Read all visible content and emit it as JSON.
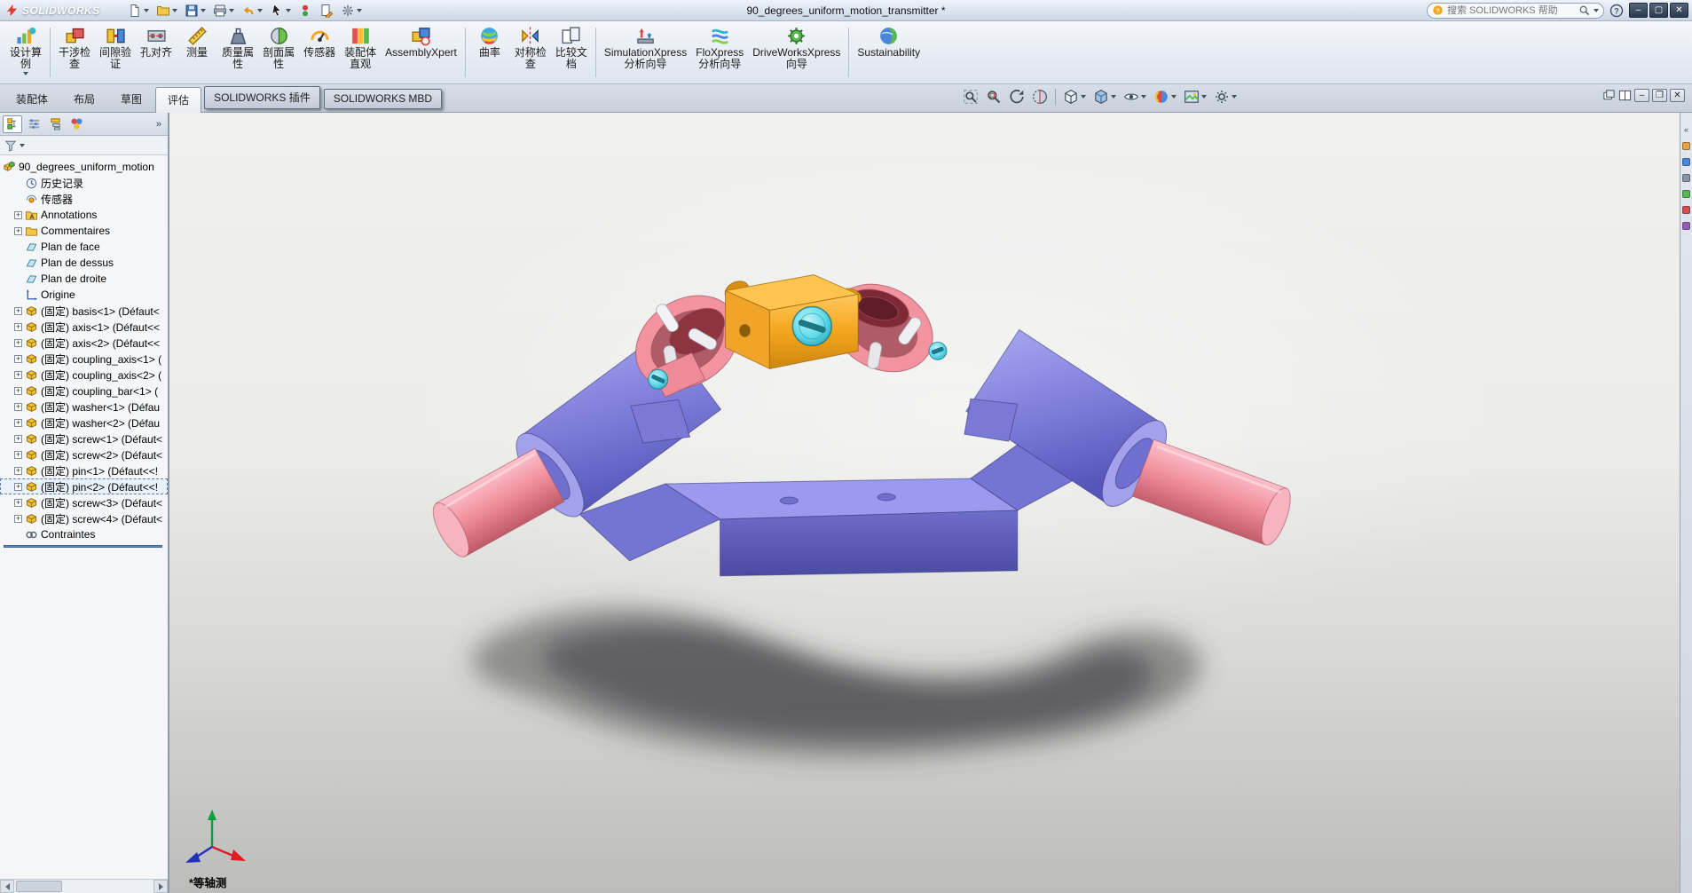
{
  "window": {
    "brand": "SOLIDWORKS",
    "title": "90_degrees_uniform_motion_transmitter *",
    "search_placeholder": "搜索 SOLIDWORKS 帮助"
  },
  "quick_access": [
    {
      "name": "new",
      "caret": true
    },
    {
      "name": "open",
      "caret": true
    },
    {
      "name": "save",
      "caret": true
    },
    {
      "name": "print",
      "caret": true
    },
    {
      "name": "undo",
      "caret": true
    },
    {
      "name": "select",
      "caret": true
    },
    {
      "name": "rebuild",
      "caret": false
    },
    {
      "name": "file-properties",
      "caret": false
    },
    {
      "name": "options",
      "caret": true
    }
  ],
  "command_manager": {
    "items": [
      {
        "label": "设计算\n例",
        "icon": "design-study",
        "caret": true
      },
      {
        "sep": true
      },
      {
        "label": "干涉检\n查",
        "icon": "interference"
      },
      {
        "label": "间隙验\n证",
        "icon": "clearance"
      },
      {
        "label": "孔对齐",
        "icon": "hole-align"
      },
      {
        "label": "测量",
        "icon": "measure"
      },
      {
        "label": "质量属\n性",
        "icon": "mass-props"
      },
      {
        "label": "剖面属\n性",
        "icon": "section-props"
      },
      {
        "label": "传感器",
        "icon": "sensor"
      },
      {
        "label": "装配体\n直观",
        "icon": "assembly-vis"
      },
      {
        "label": "AssemblyXpert",
        "icon": "assemblyxpert"
      },
      {
        "sep": true
      },
      {
        "label": "曲率",
        "icon": "curvature"
      },
      {
        "label": "对称检\n查",
        "icon": "symmetry"
      },
      {
        "label": "比较文\n档",
        "icon": "compare"
      },
      {
        "sep": true
      },
      {
        "label": "SimulationXpress\n分析向导",
        "icon": "simulationxpress"
      },
      {
        "label": "FloXpress\n分析向导",
        "icon": "floxpress"
      },
      {
        "label": "DriveWorksXpress\n向导",
        "icon": "driveworksxpress"
      },
      {
        "sep": true
      },
      {
        "label": "Sustainability",
        "icon": "sustainability"
      }
    ]
  },
  "tabs": {
    "active": 3,
    "items": [
      {
        "name": "assembly",
        "label": "装配体"
      },
      {
        "name": "layout",
        "label": "布局"
      },
      {
        "name": "sketch",
        "label": "草图"
      },
      {
        "name": "evaluate",
        "label": "评估"
      },
      {
        "name": "solidworks-addins",
        "label": "SOLIDWORKS 插件",
        "raised": true
      },
      {
        "name": "solidworks-mbd",
        "label": "SOLIDWORKS MBD",
        "raised": true
      }
    ]
  },
  "headsup": {
    "items": [
      {
        "icon": "zoom-fit"
      },
      {
        "icon": "zoom-area"
      },
      {
        "icon": "previous-view"
      },
      {
        "icon": "section-view"
      },
      {
        "sep": true
      },
      {
        "icon": "view-orientation",
        "caret": true
      },
      {
        "icon": "display-style",
        "caret": true
      },
      {
        "icon": "hide-show",
        "caret": true
      },
      {
        "icon": "edit-appearance",
        "caret": true
      },
      {
        "icon": "apply-scene",
        "caret": true
      },
      {
        "icon": "view-settings",
        "caret": true
      }
    ]
  },
  "doc_controls": [
    {
      "icon": "cascade"
    },
    {
      "icon": "pane"
    },
    {
      "glyph": "doc-minimize"
    },
    {
      "glyph": "doc-restore"
    },
    {
      "glyph": "doc-close"
    }
  ],
  "feature_panel": {
    "tabs": [
      "feature-manager",
      "property-manager",
      "configuration-manager",
      "display-manager"
    ],
    "more_glyph": "»",
    "tree": {
      "items": [
        {
          "name": "root",
          "icon": "assembly",
          "label": "90_degrees_uniform_motion",
          "root": true
        },
        {
          "name": "history",
          "icon": "history",
          "label": "历史记录"
        },
        {
          "name": "sensors",
          "icon": "sensors",
          "label": "传感器"
        },
        {
          "name": "annotations",
          "icon": "annotations",
          "label": "Annotations",
          "expand": true
        },
        {
          "name": "commentaires",
          "icon": "folder",
          "label": "Commentaires",
          "expand": true
        },
        {
          "name": "plan-de-face",
          "icon": "plane",
          "label": "Plan de face"
        },
        {
          "name": "plan-de-dessus",
          "icon": "plane",
          "label": "Plan de dessus"
        },
        {
          "name": "plan-de-droite",
          "icon": "plane",
          "label": "Plan de droite"
        },
        {
          "name": "origine",
          "icon": "origin",
          "label": "Origine"
        },
        {
          "name": "basis-1",
          "icon": "part",
          "label": "(固定) basis<1> (Défaut<",
          "expand": true
        },
        {
          "name": "axis-1",
          "icon": "part",
          "label": "(固定) axis<1> (Défaut<<",
          "expand": true
        },
        {
          "name": "axis-2",
          "icon": "part",
          "label": "(固定) axis<2> (Défaut<<",
          "expand": true
        },
        {
          "name": "coupling-axis-1",
          "icon": "part",
          "label": "(固定) coupling_axis<1> (",
          "expand": true
        },
        {
          "name": "coupling-axis-2",
          "icon": "part",
          "label": "(固定) coupling_axis<2> (",
          "expand": true
        },
        {
          "name": "coupling-bar-1",
          "icon": "part",
          "label": "(固定) coupling_bar<1> (",
          "expand": true
        },
        {
          "name": "washer-1",
          "icon": "part",
          "label": "(固定) washer<1> (Défau",
          "expand": true
        },
        {
          "name": "washer-2",
          "icon": "part",
          "label": "(固定) washer<2> (Défau",
          "expand": true
        },
        {
          "name": "screw-1",
          "icon": "part",
          "label": "(固定) screw<1> (Défaut<",
          "expand": true
        },
        {
          "name": "screw-2",
          "icon": "part",
          "label": "(固定) screw<2> (Défaut<",
          "expand": true
        },
        {
          "name": "pin-1",
          "icon": "part",
          "label": "(固定) pin<1> (Défaut<<!",
          "expand": true
        },
        {
          "name": "pin-2",
          "icon": "part",
          "label": "(固定) pin<2> (Défaut<<!",
          "expand": true,
          "selected": true
        },
        {
          "name": "screw-3",
          "icon": "part",
          "label": "(固定) screw<3> (Défaut<",
          "expand": true
        },
        {
          "name": "screw-4",
          "icon": "part",
          "label": "(固定) screw<4> (Défaut<",
          "expand": true
        },
        {
          "name": "contraintes",
          "icon": "mates",
          "label": "Contraintes"
        }
      ]
    }
  },
  "task_pane": {
    "expand_glyph": "«",
    "icons": [
      {
        "name": "resources",
        "color": "#e8a33d"
      },
      {
        "name": "design-library",
        "color": "#4a86d9"
      },
      {
        "name": "file-explorer",
        "color": "#8a94a3"
      },
      {
        "name": "view-palette",
        "color": "#57b94d"
      },
      {
        "name": "appearances",
        "color": "#d94a4a"
      },
      {
        "name": "custom-properties",
        "color": "#9b59b6"
      }
    ]
  },
  "viewport": {
    "view_label": "*等轴测"
  },
  "colors": {
    "model_purple": "#8181dd",
    "model_purple_dark": "#5a5abd",
    "model_pink": "#f2929f",
    "model_orange": "#f4a81f",
    "model_cyan": "#5fd9e9",
    "shadow": "#3f3f42",
    "titlebar_top": "#eef3fa",
    "titlebar_bottom": "#ccd7e5"
  }
}
